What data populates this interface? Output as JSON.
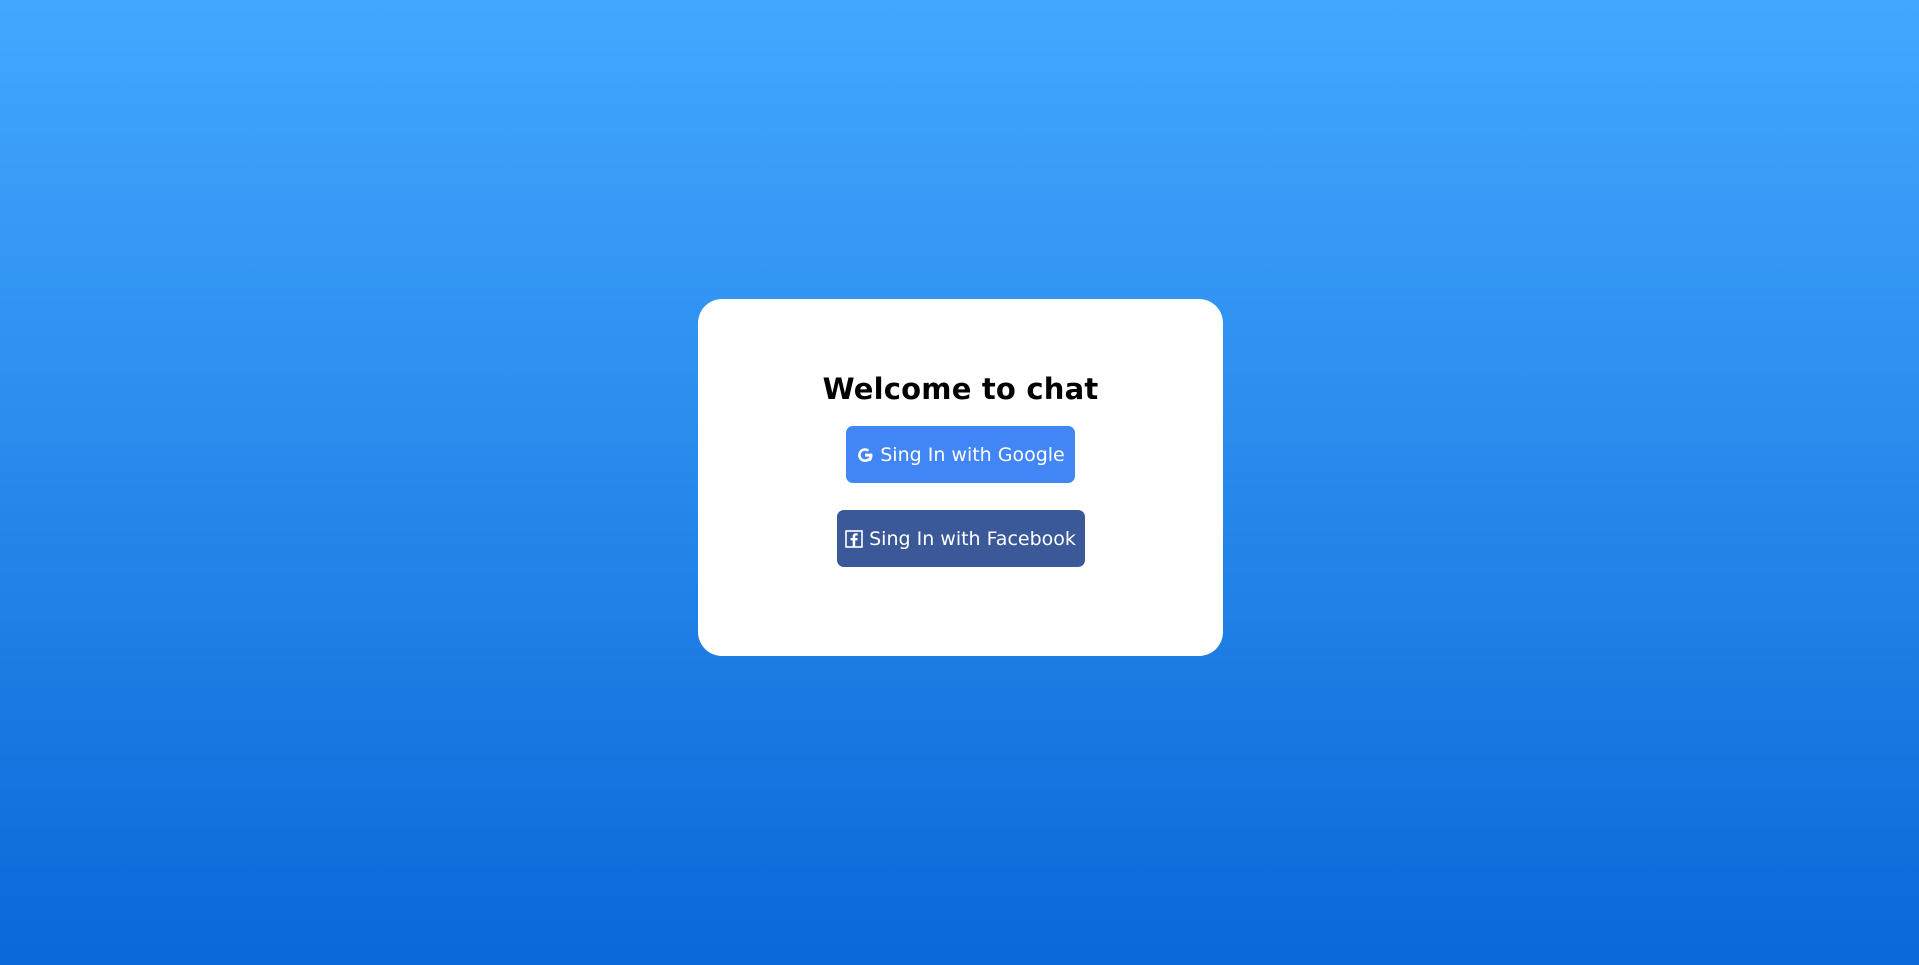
{
  "page": {
    "background_top": "#42a8ff",
    "background_bottom": "#0a68d8"
  },
  "card": {
    "title": "Welcome to chat",
    "buttons": [
      {
        "label": "Sing In with Google",
        "icon": "google-icon",
        "color": "#4285f4"
      },
      {
        "label": "Sing In with Facebook",
        "icon": "facebook-icon",
        "color": "#3b5998"
      }
    ]
  }
}
